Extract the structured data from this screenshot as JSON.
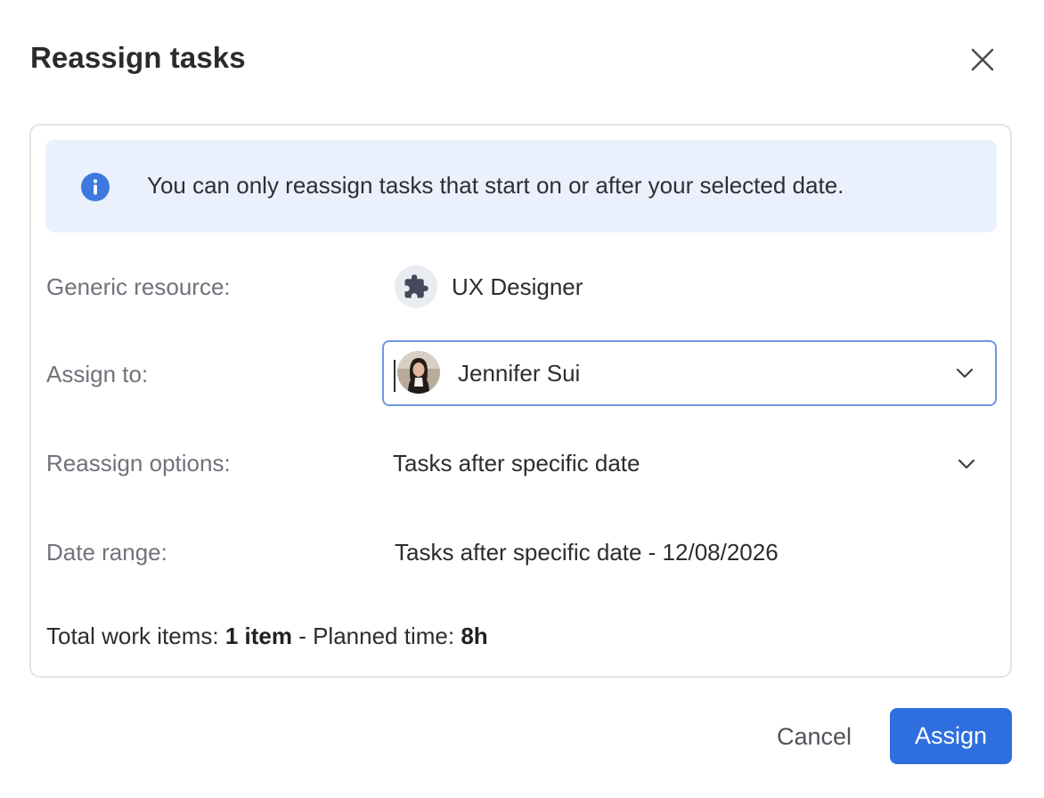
{
  "dialog": {
    "title": "Reassign tasks"
  },
  "info_banner": {
    "icon": "info-icon",
    "text": "You can only reassign tasks that start on or after your selected date."
  },
  "generic_resource": {
    "label": "Generic resource:",
    "icon": "puzzle-piece-icon",
    "value": "UX Designer"
  },
  "assign_to": {
    "label": "Assign to:",
    "value": "Jennifer Sui"
  },
  "reassign_options": {
    "label": "Reassign options:",
    "value": "Tasks after specific date"
  },
  "date_range": {
    "label": "Date range:",
    "value": "Tasks after specific date - 12/08/2026"
  },
  "totals": {
    "work_items_label": "Total work items: ",
    "work_items_value": "1 item",
    "separator": " - ",
    "planned_time_label": "Planned time: ",
    "planned_time_value": "8h"
  },
  "footer": {
    "cancel_label": "Cancel",
    "assign_label": "Assign"
  },
  "colors": {
    "primary": "#2f6ede",
    "info_background": "#eaf1fd",
    "info_icon": "#3e79e0",
    "focus_border": "#6e97e4"
  }
}
